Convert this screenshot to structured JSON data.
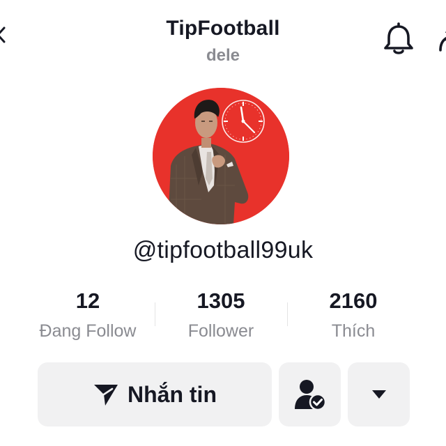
{
  "header": {
    "title": "TipFootball",
    "subtitle": "dele",
    "left_icon": "back-arrow-icon",
    "notification_icon": "bell-icon",
    "share_icon": "share-icon"
  },
  "profile": {
    "avatar": "profile-photo",
    "avatar_background": "#e8322b",
    "username": "@tipfootball99uk"
  },
  "stats": [
    {
      "value": "12",
      "label": "Đang Follow"
    },
    {
      "value": "1305",
      "label": "Follower"
    },
    {
      "value": "2160",
      "label": "Thích"
    }
  ],
  "actions": {
    "message_label": "Nhắn tin",
    "message_icon": "send-icon",
    "friend_icon": "user-check-icon",
    "more_icon": "caret-down-icon"
  },
  "colors": {
    "text_primary": "#161823",
    "text_secondary": "#8a8b91",
    "button_background": "#f1f1f2"
  }
}
